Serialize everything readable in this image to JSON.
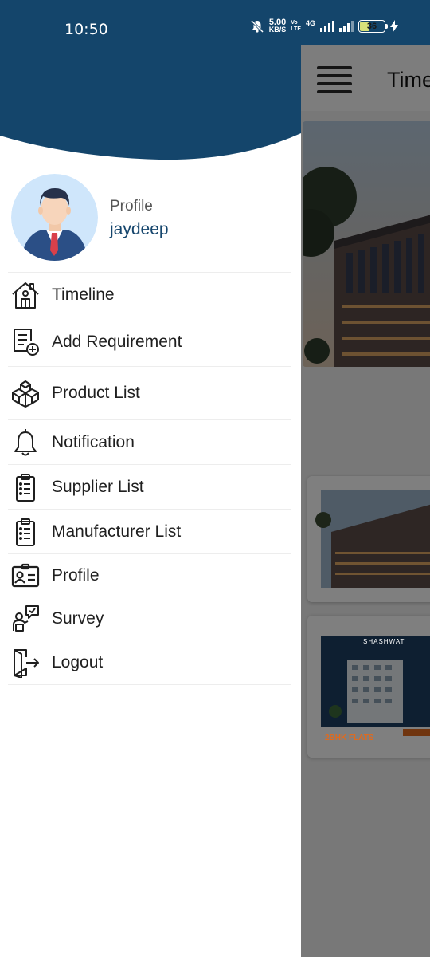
{
  "status_bar": {
    "time": "10:50",
    "net_speed_value": "5.00",
    "net_speed_unit": "KB/S",
    "volte_top": "Vo",
    "volte_bottom": "LTE",
    "network": "4G",
    "battery_level": "36"
  },
  "app": {
    "title": "Time",
    "card3_brand": "SHASHWAT",
    "card3_tagline": "2BHK FLATS"
  },
  "drawer": {
    "profile_caption": "Profile",
    "user_name": "jaydeep",
    "menu": [
      {
        "label": "Timeline",
        "icon": "home-icon"
      },
      {
        "label": "Add Requirement",
        "icon": "add-document-icon"
      },
      {
        "label": "Product List",
        "icon": "boxes-icon"
      },
      {
        "label": "Notification",
        "icon": "bell-icon"
      },
      {
        "label": "Supplier List",
        "icon": "clipboard-list-icon"
      },
      {
        "label": "Manufacturer List",
        "icon": "clipboard-list-icon"
      },
      {
        "label": "Profile",
        "icon": "id-card-icon"
      },
      {
        "label": "Survey",
        "icon": "survey-icon"
      },
      {
        "label": "Logout",
        "icon": "logout-icon"
      }
    ]
  },
  "colors": {
    "primary": "#14456b",
    "text": "#1f1f1f",
    "overlay": "rgba(0,0,0,0.5)"
  }
}
